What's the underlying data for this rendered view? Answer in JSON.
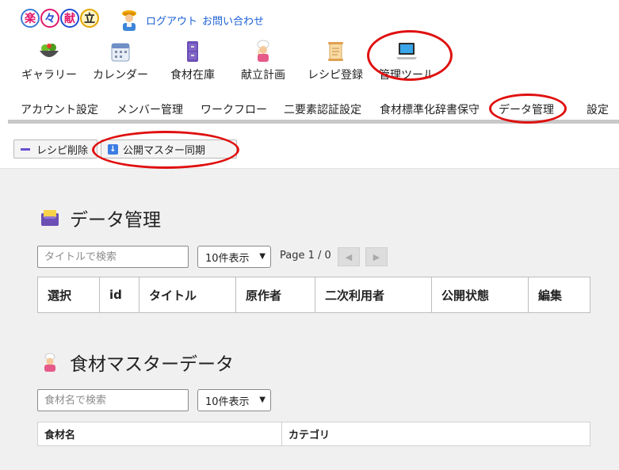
{
  "header": {
    "logo_chars": [
      "楽",
      "々",
      "献",
      "立"
    ],
    "logout_label": "ログアウト",
    "contact_label": "お問い合わせ",
    "nav": [
      {
        "label": "ギャラリー",
        "icon": "salad-bowl-icon"
      },
      {
        "label": "カレンダー",
        "icon": "calendar-icon"
      },
      {
        "label": "食材在庫",
        "icon": "cabinet-icon"
      },
      {
        "label": "献立計画",
        "icon": "cook-icon"
      },
      {
        "label": "レシピ登録",
        "icon": "scroll-icon"
      },
      {
        "label": "管理ツール",
        "icon": "laptop-icon"
      }
    ],
    "subnav": [
      "アカウント設定",
      "メンバー管理",
      "ワークフロー",
      "二要素認証設定",
      "食材標準化辞書保守",
      "データ管理",
      "設定"
    ]
  },
  "toolbar": {
    "delete_label": "レシピ削除",
    "sync_label": "公開マスター同期"
  },
  "data_section": {
    "title": "データ管理",
    "search_placeholder": "タイトルで検索",
    "page_size": "10件表示",
    "page_info": "Page 1 / 0",
    "columns": [
      "選択",
      "id",
      "タイトル",
      "原作者",
      "二次利用者",
      "公開状態",
      "編集"
    ]
  },
  "food_section": {
    "title": "食材マスターデータ",
    "search_placeholder": "食材名で検索",
    "page_size": "10件表示",
    "columns": [
      "食材名",
      "カテゴリ"
    ]
  },
  "colors": {
    "annotation_red": "#e01010",
    "link_blue": "#1a5fd6",
    "page_bg": "#f0f0f0"
  }
}
